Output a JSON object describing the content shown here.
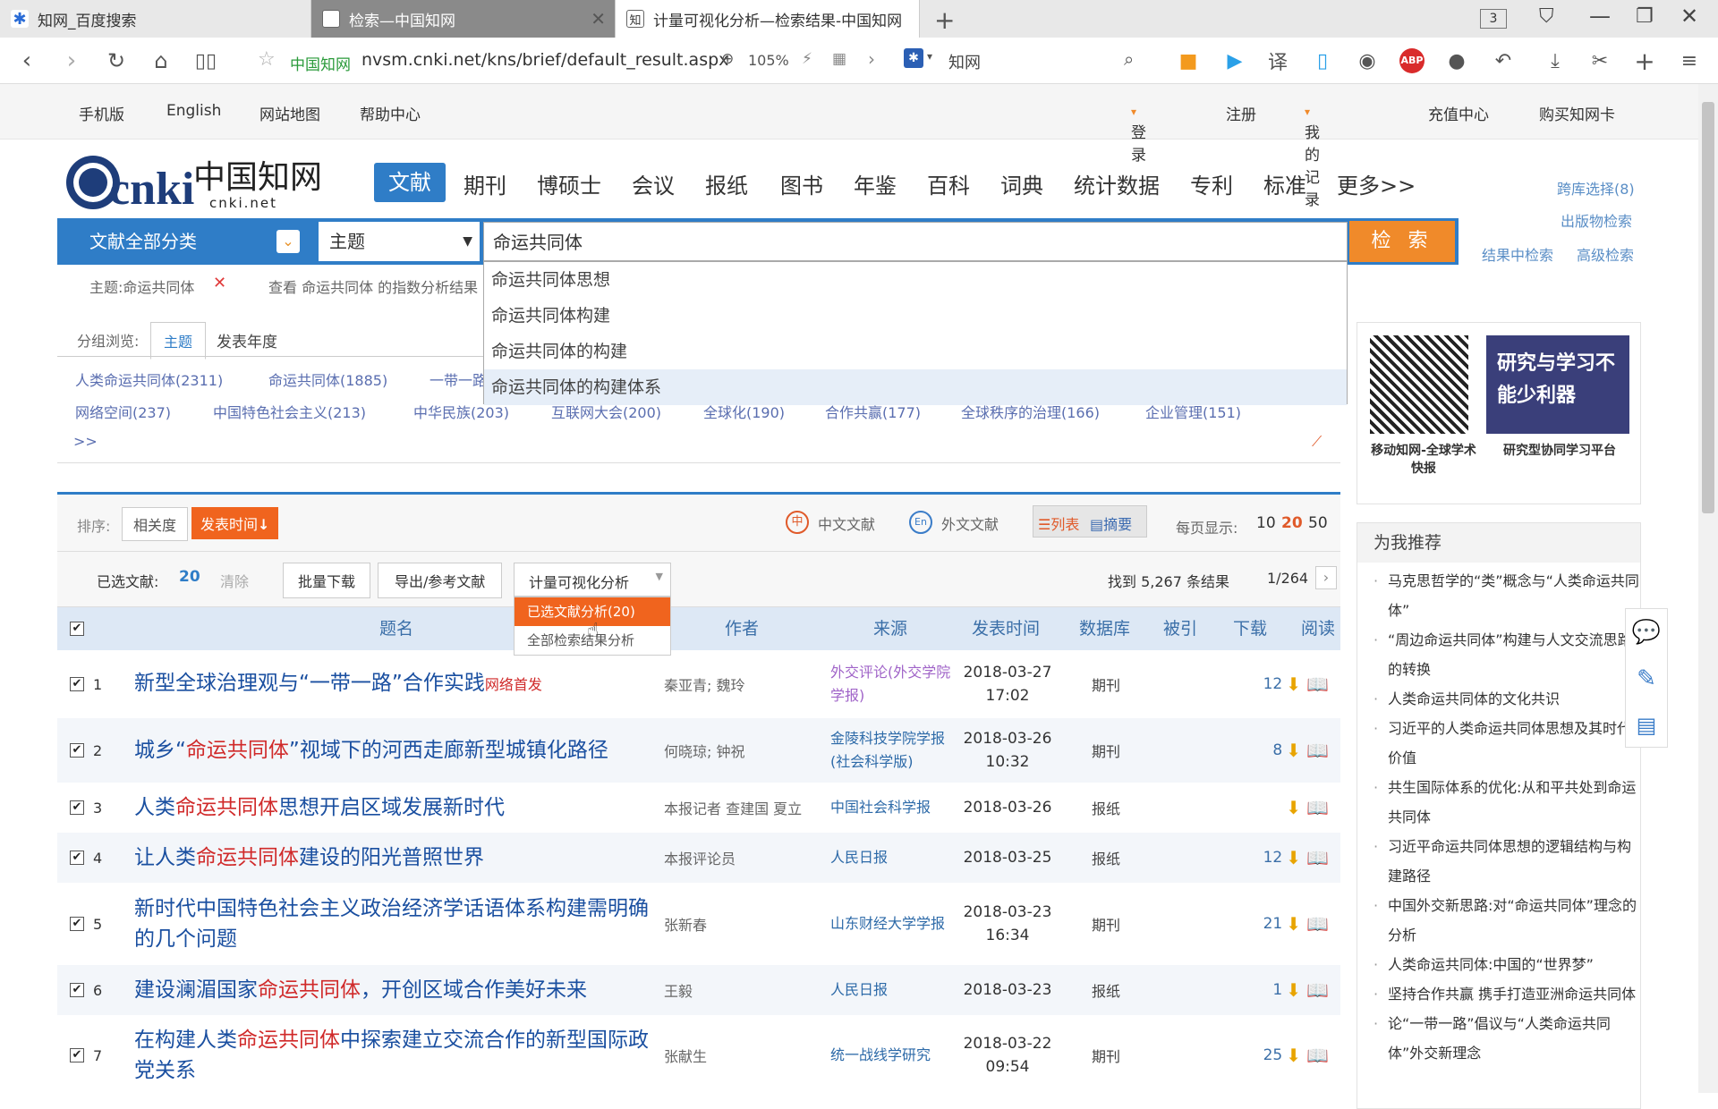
{
  "browser": {
    "tabs": [
      {
        "title": "知网_百度搜索",
        "state": "normal"
      },
      {
        "title": "检索—中国知网",
        "state": "dim"
      },
      {
        "title": "计量可视化分析—检索结果-中国知网",
        "state": "active"
      }
    ],
    "tab_count": "3",
    "site_name": "中国知网",
    "url": "nvsm.cnki.net/kns/brief/default_result.aspx",
    "zoom": "105%",
    "search_engine": "知网",
    "abp": "ABP",
    "translate": "译"
  },
  "site_top": {
    "left": [
      "手机版",
      "English",
      "网站地图",
      "帮助中心"
    ],
    "login": "登录",
    "register": "注册",
    "records": "我的记录",
    "recharge": "充值中心",
    "buy": "购买知网卡"
  },
  "logo": {
    "main": "cnki",
    "cn": "中国知网",
    "domain": "cnki.net"
  },
  "nav": [
    "文献",
    "期刊",
    "博硕士",
    "会议",
    "报纸",
    "图书",
    "年鉴",
    "百科",
    "词典",
    "统计数据",
    "专利",
    "标准",
    "更多>>"
  ],
  "right_links": {
    "cross": "跨库选择(8)",
    "pub": "出版物检索",
    "in_result": "结果中检索",
    "advanced": "高级检索"
  },
  "search": {
    "category": "文献全部分类",
    "field": "主题",
    "query": "命运共同体",
    "button": "检 索",
    "suggestions": [
      "命运共同体思想",
      "命运共同体构建",
      "命运共同体的构建",
      "命运共同体的构建体系"
    ]
  },
  "filter": {
    "tag": "主题:命运共同体",
    "index_link": "查看 命运共同体 的指数分析结果"
  },
  "group": {
    "label": "分组浏览:",
    "tabs": [
      "主题",
      "发表年度"
    ],
    "row1": [
      "人类命运共同体(2311)",
      "命运共同体(1885)",
      "一带一路"
    ],
    "row2": [
      "网络空间(237)",
      "中国特色社会主义(213)",
      "中华民族(203)",
      "互联网大会(200)",
      "全球化(190)",
      "合作共赢(177)",
      "全球秩序的治理(166)",
      "企业管理(151)"
    ],
    "more": ">>"
  },
  "sort": {
    "label": "排序:",
    "relevance": "相关度",
    "date": "发表时间",
    "cn": "中文文献",
    "en": "外文文献",
    "list": "列表",
    "abstract": "摘要",
    "per_page_label": "每页显示:",
    "per_page": [
      "10",
      "20",
      "50"
    ],
    "per_page_selected": "20"
  },
  "toolbar": {
    "selected_label": "已选文献:",
    "selected_count": "20",
    "clear": "清除",
    "batch": "批量下载",
    "export": "导出/参考文献",
    "viz": "计量可视化分析",
    "viz_menu": [
      "已选文献分析(20)",
      "全部检索结果分析"
    ],
    "found": "找到 5,267 条结果",
    "pages": "1/264"
  },
  "table": {
    "headers": [
      "题名",
      "作者",
      "来源",
      "发表时间",
      "数据库",
      "被引",
      "下载",
      "阅读"
    ],
    "rows": [
      {
        "n": "1",
        "title_pre": "新型全球治理观与“一带一路”合作实践",
        "title_hl": "",
        "title_post": "",
        "tag": "网络首发",
        "author": "秦亚青; 魏玲",
        "source": "外交评论(外交学院学报)",
        "date": "2018-03-27",
        "time": "17:02",
        "db": "期刊",
        "cite": "",
        "dl": "12"
      },
      {
        "n": "2",
        "title_pre": "城乡“",
        "title_hl": "命运共同体",
        "title_post": "”视域下的河西走廊新型城镇化路径",
        "tag": "",
        "author": "何晓琼; 钟祝",
        "source": "金陵科技学院学报(社会科学版)",
        "date": "2018-03-26",
        "time": "10:32",
        "db": "期刊",
        "cite": "",
        "dl": "8"
      },
      {
        "n": "3",
        "title_pre": "人类",
        "title_hl": "命运共同体",
        "title_post": "思想开启区域发展新时代",
        "tag": "",
        "author": "本报记者 查建国 夏立",
        "source": "中国社会科学报",
        "date": "2018-03-26",
        "time": "",
        "db": "报纸",
        "cite": "",
        "dl": ""
      },
      {
        "n": "4",
        "title_pre": "让人类",
        "title_hl": "命运共同体",
        "title_post": "建设的阳光普照世界",
        "tag": "",
        "author": "本报评论员",
        "source": "人民日报",
        "date": "2018-03-25",
        "time": "",
        "db": "报纸",
        "cite": "",
        "dl": "12"
      },
      {
        "n": "5",
        "title_pre": "新时代中国特色社会主义政治经济学话语体系构建需明确的几个问题",
        "title_hl": "",
        "title_post": "",
        "tag": "",
        "author": "张新春",
        "source": "山东财经大学学报",
        "date": "2018-03-23",
        "time": "16:34",
        "db": "期刊",
        "cite": "",
        "dl": "21"
      },
      {
        "n": "6",
        "title_pre": "建设澜湄国家",
        "title_hl": "命运共同体",
        "title_post": "，开创区域合作美好未来",
        "tag": "",
        "author": "王毅",
        "source": "人民日报",
        "date": "2018-03-23",
        "time": "",
        "db": "报纸",
        "cite": "",
        "dl": "1"
      },
      {
        "n": "7",
        "title_pre": "在构建人类",
        "title_hl": "命运共同体",
        "title_post": "中探索建立交流合作的新型国际政党关系",
        "tag": "",
        "author": "张献生",
        "source": "统一战线学研究",
        "date": "2018-03-22",
        "time": "09:54",
        "db": "期刊",
        "cite": "",
        "dl": "25"
      }
    ]
  },
  "sidebar": {
    "qr_caption": "移动知网-全球学术快报",
    "promo_title": "研究与学习不能少利器",
    "promo_caption": "研究型协同学习平台",
    "recommend_title": "为我推荐",
    "recommend": [
      "马克思哲学的“类”概念与“人类命运共同体”",
      "“周边命运共同体”构建与人文交流思路的转换",
      "人类命运共同体的文化共识",
      "习近平的人类命运共同体思想及其时代价值",
      "共生国际体系的优化:从和平共处到命运共同体",
      "习近平命运共同体思想的逻辑结构与构建路径",
      "中国外交新思路:对“命运共同体”理念的分析",
      "人类命运共同体:中国的“世界梦”",
      "坚持合作共赢 携手打造亚洲命运共同体",
      "论“一带一路”倡议与“人类命运共同体”外交新理念"
    ]
  },
  "colors": {
    "brand": "#2f7dc7",
    "accent": "#f08a2a",
    "highlight": "#d02a2a"
  }
}
